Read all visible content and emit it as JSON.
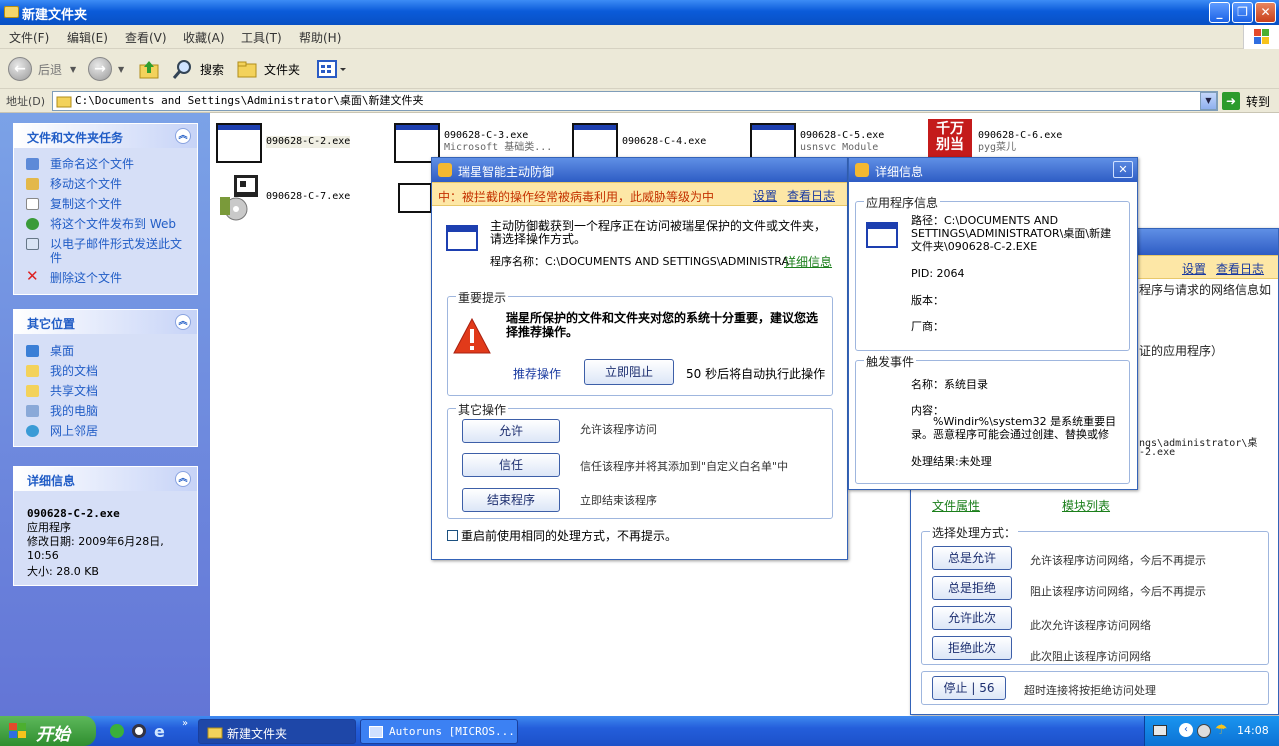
{
  "window": {
    "title": "新建文件夹"
  },
  "menu": [
    "文件(F)",
    "编辑(E)",
    "查看(V)",
    "收藏(A)",
    "工具(T)",
    "帮助(H)"
  ],
  "toolbar": {
    "back": "后退",
    "search": "搜索",
    "folder": "文件夹"
  },
  "address": {
    "label": "地址(D)",
    "path": "C:\\Documents and Settings\\Administrator\\桌面\\新建文件夹",
    "go": "转到"
  },
  "tasks": {
    "title": "文件和文件夹任务",
    "items": [
      "重命名这个文件",
      "移动这个文件",
      "复制这个文件",
      "将这个文件发布到 Web",
      "以电子邮件形式发送此文件",
      "删除这个文件"
    ]
  },
  "places": {
    "title": "其它位置",
    "items": [
      "桌面",
      "我的文档",
      "共享文档",
      "我的电脑",
      "网上邻居"
    ]
  },
  "details": {
    "title": "详细信息",
    "name": "090628-C-2.exe",
    "type": "应用程序",
    "modified": "修改日期: 2009年6月28日, 10:56",
    "size": "大小: 28.0 KB"
  },
  "files": [
    {
      "name": "090628-C-2.exe",
      "sub": ""
    },
    {
      "name": "090628-C-3.exe",
      "sub": "Microsoft 基础类..."
    },
    {
      "name": "090628-C-4.exe",
      "sub": ""
    },
    {
      "name": "090628-C-5.exe",
      "sub": "usnsvc Module"
    },
    {
      "name": "090628-C-6.exe",
      "sub": "pyg菜儿"
    },
    {
      "name": "090628-C-7.exe",
      "sub": ""
    }
  ],
  "icon6_text": "千万\n别当",
  "dialog1": {
    "title": "瑞星智能主动防御",
    "warning": "中：被拦截的操作经常被病毒利用，此威胁等级为中",
    "settings": "设置",
    "logs": "查看日志",
    "intro": "主动防御截获到一个程序正在访问被瑞星保护的文件或文件夹，请选择操作方式。",
    "program_label": "程序名称：C:\\DOCUMENTS AND SETTINGS\\ADMINISTRA",
    "detail_link": "详细信息",
    "important_label": "重要提示",
    "important_text": "瑞星所保护的文件和文件夹对您的系统十分重要，建议您选择推荐操作。",
    "recommend": "推荐操作",
    "block_now": "立即阻止",
    "countdown": "50 秒后将自动执行此操作",
    "other_label": "其它操作",
    "actions": [
      {
        "btn": "允许",
        "desc": "允许该程序访问"
      },
      {
        "btn": "信任",
        "desc": "信任该程序并将其添加到\"自定义白名单\"中"
      },
      {
        "btn": "结束程序",
        "desc": "立即结束该程序"
      }
    ],
    "remember": "重启前使用相同的处理方式，不再提示。"
  },
  "dialog2": {
    "title": "详细信息",
    "app_label": "应用程序信息",
    "path": "路径：C:\\DOCUMENTS AND SETTINGS\\ADMINISTRATOR\\桌面\\新建文件夹\\090628-C-2.EXE",
    "pid": "PID: 2064",
    "version": "版本：",
    "vendor": "厂商：",
    "event_label": "触发事件",
    "ev_name": "名称：系统目录",
    "ev_content_label": "内容：",
    "ev_content": "%Windir%\\system32 是系统重要目录。恶意程序可能会通过创建、替换或修",
    "ev_result": "处理结果:未处理"
  },
  "dialog3": {
    "settings": "设置",
    "logs": "查看日志",
    "text1": "程序与请求的网络信息如",
    "text2": "证的应用程序）",
    "text3": "ngs\\administrator\\桌",
    "text4": "-2.exe",
    "file_props": "文件属性",
    "modules": "模块列表",
    "choose_label": "选择处理方式：",
    "options": [
      {
        "btn": "总是允许",
        "desc": "允许该程序访问网络，今后不再提示"
      },
      {
        "btn": "总是拒绝",
        "desc": "阻止该程序访问网络，今后不再提示"
      },
      {
        "btn": "允许此次",
        "desc": "此次允许该程序访问网络"
      },
      {
        "btn": "拒绝此次",
        "desc": "此次阻止该程序访问网络"
      }
    ],
    "stop": "停止 | 56",
    "timeout": "超时连接将按拒绝访问处理"
  },
  "taskbar": {
    "start": "开始",
    "items": [
      "新建文件夹",
      "Autoruns [MICROS..."
    ],
    "clock": "14:08"
  }
}
